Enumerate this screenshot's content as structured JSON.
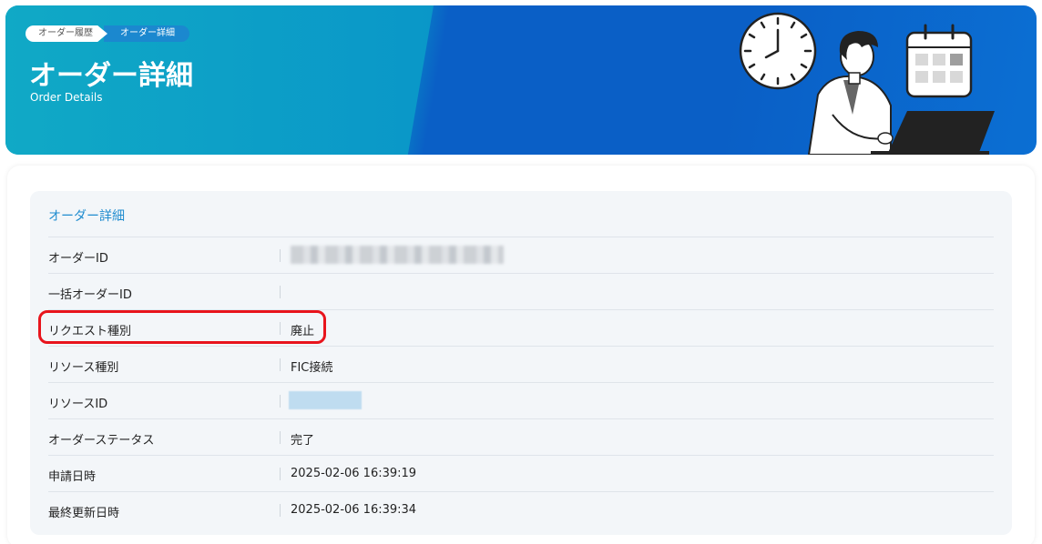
{
  "breadcrumb": {
    "items": [
      "オーダー履歴",
      "オーダー詳細"
    ]
  },
  "header": {
    "title": "オーダー詳細",
    "subtitle": "Order Details"
  },
  "section": {
    "title": "オーダー詳細",
    "rows": [
      {
        "label": "オーダーID",
        "value": ""
      },
      {
        "label": "一括オーダーID",
        "value": ""
      },
      {
        "label": "リクエスト種別",
        "value": "廃止"
      },
      {
        "label": "リソース種別",
        "value": "FIC接続"
      },
      {
        "label": "リソースID",
        "value": ""
      },
      {
        "label": "オーダーステータス",
        "value": "完了"
      },
      {
        "label": "申請日時",
        "value": "2025-02-06 16:39:19"
      },
      {
        "label": "最終更新日時",
        "value": "2025-02-06 16:39:34"
      }
    ]
  },
  "colors": {
    "accent": "#1f8ccf",
    "highlight": "#e8141c",
    "banner_left": "#0aa6c4",
    "banner_right": "#0a5fc6"
  },
  "icons": [
    "clock-icon",
    "calendar-icon",
    "person-with-laptop-illustration"
  ]
}
